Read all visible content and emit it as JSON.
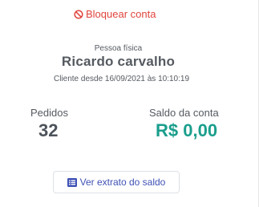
{
  "customer": {
    "block_label": "Bloquear conta",
    "person_type": "Pessoa física",
    "name": "Ricardo carvalho",
    "since_text": "Cliente desde 16/09/2021 às 10:10:19"
  },
  "stats": {
    "orders_label": "Pedidos",
    "orders_value": "32",
    "balance_label": "Saldo da conta",
    "balance_value": "R$ 0,00"
  },
  "actions": {
    "statement_label": "Ver extrato do saldo"
  },
  "icons": {
    "block": "ban-icon",
    "statement": "list-alt-icon"
  },
  "colors": {
    "danger": "#e0443c",
    "balance": "#1a9e8c",
    "link": "#3f51b5",
    "text": "#555a60"
  }
}
